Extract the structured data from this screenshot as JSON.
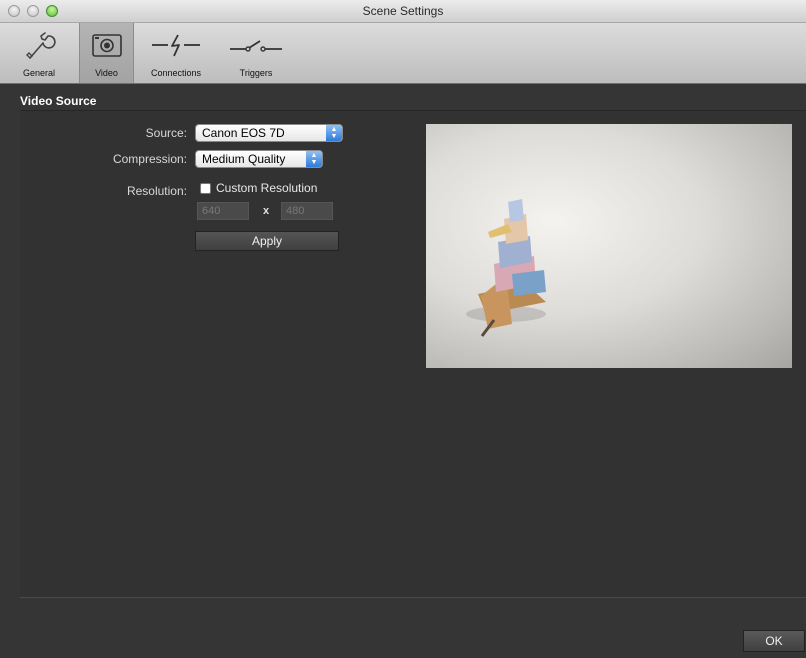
{
  "window": {
    "title": "Scene Settings"
  },
  "toolbar": {
    "items": [
      {
        "label": "General",
        "icon": "wrench-icon"
      },
      {
        "label": "Video",
        "icon": "camera-icon"
      },
      {
        "label": "Connections",
        "icon": "lightning-connector-icon"
      },
      {
        "label": "Triggers",
        "icon": "switch-icon"
      }
    ],
    "active": "Video"
  },
  "section": {
    "title": "Video Source"
  },
  "form": {
    "source": {
      "label": "Source:",
      "value": "Canon EOS 7D"
    },
    "compression": {
      "label": "Compression:",
      "value": "Medium Quality"
    },
    "resolution": {
      "label": "Resolution:",
      "custom_label": "Custom Resolution",
      "custom_checked": false,
      "width_placeholder": "640",
      "separator": "x",
      "height_placeholder": "480"
    },
    "apply_label": "Apply"
  },
  "footer": {
    "ok_label": "OK"
  },
  "colors": {
    "background": "#353535",
    "accent_blue": "#2f7ad9",
    "text": "#ffffff"
  }
}
